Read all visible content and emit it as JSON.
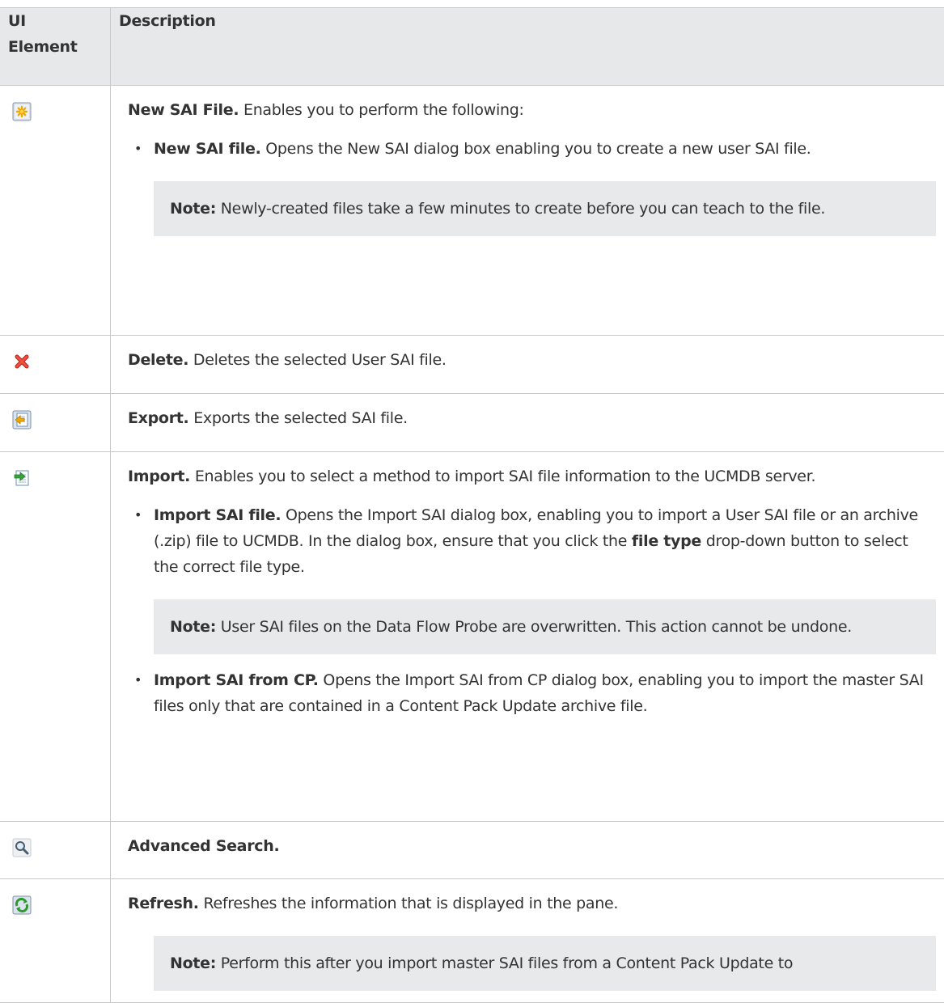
{
  "table": {
    "header": {
      "col1_line1": "UI",
      "col1_line2": "Element",
      "col2": "Description"
    },
    "rows": [
      {
        "icon": "new-file-icon",
        "title": "New SAI File.",
        "text": " Enables you to perform the following:",
        "items": [
          {
            "title": "New SAI file.",
            "text": " Opens the New SAI dialog box enabling you to create a new user SAI file."
          }
        ],
        "note": {
          "label": "Note:",
          "text": " Newly-created files take a few minutes to create before you can teach to the file."
        }
      },
      {
        "icon": "delete-icon",
        "title": "Delete.",
        "text": " Deletes the selected User SAI file."
      },
      {
        "icon": "export-icon",
        "title": "Export.",
        "text": " Exports the selected SAI file."
      },
      {
        "icon": "import-icon",
        "title": "Import.",
        "text": " Enables you to select a method to import SAI file information to the UCMDB server.",
        "items": [
          {
            "title": "Import SAI file.",
            "text": " Opens the Import SAI dialog box, enabling you to import a User SAI file or an archive (.zip) file to UCMDB. In the dialog box, ensure that you click the ",
            "bold_inline": "file type",
            "text_after": " drop-down button to select the correct file type."
          },
          {
            "title": "Import SAI from CP.",
            "text": " Opens the Import SAI from CP dialog box, enabling you to import the master SAI files only that are contained in a Content Pack Update archive file."
          }
        ],
        "note": {
          "label": "Note:",
          "text": " User SAI files on the Data Flow Probe are overwritten. This action cannot be undone."
        }
      },
      {
        "icon": "search-icon",
        "title": "Advanced Search."
      },
      {
        "icon": "refresh-icon",
        "title": "Refresh.",
        "text": " Refreshes the information that is displayed in the pane.",
        "note": {
          "label": "Note:",
          "text": " Perform this after you import master SAI files from a Content Pack Update to"
        }
      }
    ]
  },
  "colors": {
    "header_bg": "#e7e8e9",
    "note_bg": "#e7e9ea",
    "border": "#c8c8c8",
    "text": "#333333"
  }
}
